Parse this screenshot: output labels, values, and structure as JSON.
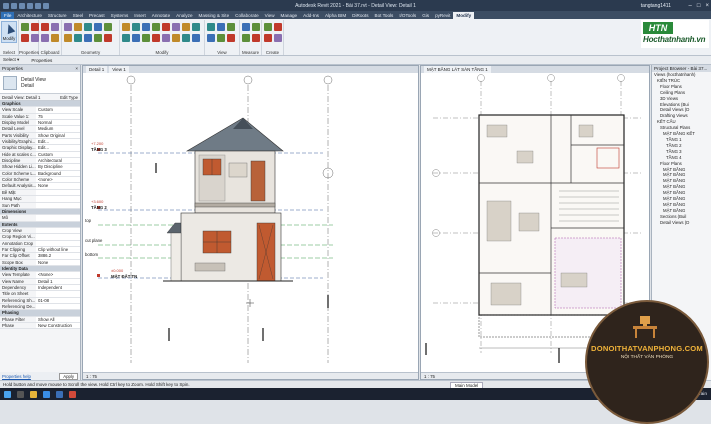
{
  "app": {
    "title": "Autodesk Revit 2021 - Bài 37.rvt - Detail View: Detail 1",
    "user": "tangtang1411"
  },
  "tabs": [
    "File",
    "Architecture",
    "Structure",
    "Steel",
    "Precast",
    "Systems",
    "Insert",
    "Annotate",
    "Analyze",
    "Massing & Site",
    "Collaborate",
    "View",
    "Manage",
    "Add-Ins",
    "Alpha BIM",
    "DiRoots",
    "Bot Tools",
    "I/OTools",
    "Gis",
    "pyRevit",
    "Modify"
  ],
  "active_tab": "Modify",
  "ribbon_groups": [
    "Select",
    "Properties",
    "Clipboard",
    "Geometry",
    "Modify",
    "View",
    "Measure",
    "Create"
  ],
  "modify_button": "Modify",
  "logo": {
    "mark": "HTN",
    "text": "Hocthatnhanh.vn",
    "color": "#2a8a3a"
  },
  "options_bar": {
    "select_label": "Select ▾",
    "properties_label": "Properties"
  },
  "properties": {
    "title": "Properties",
    "type_name": "Detail View",
    "type_sub": "Detail",
    "instance_label": "Detail View: Detail 1",
    "edit_type": "Edit Type",
    "rows": [
      {
        "section": "Graphics"
      },
      {
        "k": "View Scale",
        "v": "Custom"
      },
      {
        "k": "Scale Value 1:",
        "v": "75"
      },
      {
        "k": "Display Model",
        "v": "Normal"
      },
      {
        "k": "Detail Level",
        "v": "Medium"
      },
      {
        "k": "Parts Visibility",
        "v": "Show Original"
      },
      {
        "k": "Visibility/Graphi...",
        "v": "Edit..."
      },
      {
        "k": "Graphic Display...",
        "v": "Edit..."
      },
      {
        "k": "Hide at scales c...",
        "v": "Custom"
      },
      {
        "k": "Discipline",
        "v": "Architectural"
      },
      {
        "k": "Show Hidden Li...",
        "v": "By Discipline"
      },
      {
        "k": "Color Scheme L...",
        "v": "Background"
      },
      {
        "k": "Color Scheme",
        "v": "<none>"
      },
      {
        "k": "Default Analysis...",
        "v": "None"
      },
      {
        "k": "Bề Mặt",
        "v": ""
      },
      {
        "k": "Hang Mục",
        "v": ""
      },
      {
        "k": "Sun Path",
        "v": ""
      },
      {
        "section": "Dimensions"
      },
      {
        "k": "Mô",
        "v": ""
      },
      {
        "section": "Extents"
      },
      {
        "k": "Crop View",
        "v": ""
      },
      {
        "k": "Crop Region Vi...",
        "v": ""
      },
      {
        "k": "Annotation Crop",
        "v": ""
      },
      {
        "k": "Far Clipping",
        "v": "Clip without line"
      },
      {
        "k": "Far Clip Offset",
        "v": "3886.2"
      },
      {
        "k": "Scope Box",
        "v": "None"
      },
      {
        "section": "Identity Data"
      },
      {
        "k": "View Template",
        "v": "<None>"
      },
      {
        "k": "View Name",
        "v": "Detail 1"
      },
      {
        "k": "Dependency",
        "v": "Independent"
      },
      {
        "k": "Title on Sheet",
        "v": ""
      },
      {
        "k": "Referencing Sh...",
        "v": "01-08"
      },
      {
        "k": "Referencing De...",
        "v": ""
      },
      {
        "section": "Phasing"
      },
      {
        "k": "Phase Filter",
        "v": "Show All"
      },
      {
        "k": "Phase",
        "v": "New Construction"
      }
    ],
    "help_link": "Properties help",
    "apply": "Apply"
  },
  "views": {
    "left_tabs": [
      "Detail 1",
      "View 1"
    ],
    "right_tab": "MẶT BẰNG LÁT SÀN TẦNG 1",
    "left_scale": "1 : 75",
    "right_scale": "1 : 75",
    "levels": [
      "TẦNG 3",
      "TẦNG 2",
      "top",
      "cut plane",
      "bottom",
      "MẶT ĐẤT TN"
    ],
    "level_elev": [
      "+7.200",
      "+3.600",
      "±0.000"
    ]
  },
  "browser": {
    "title": "Project Browser - Bài 37...",
    "items": [
      "Views (hocthatnhanh)",
      "KIẾN TRÚC",
      "Floor Plans",
      "Ceiling Plans",
      "3D Views",
      "Elevations (Bui",
      "Detail Views (D",
      "Drafting Views",
      "KẾT CẤU",
      "Structural Plans",
      "MẶT BẰNG KẾT",
      "TẦNG 1",
      "TẦNG 2",
      "TẦNG 3",
      "TẦNG 4",
      "Floor Plans",
      "MẶT BẰNG",
      "MẶT BẰNG",
      "MẶT BẰNG",
      "MẶT BẰNG",
      "MẶT BẰNG",
      "MẶT BẰNG",
      "MẶT BẰNG",
      "MẶT BẰNG",
      "Sections (Buil",
      "Detail Views (D"
    ]
  },
  "status_bar": "Hold button and move mouse to Scroll the view. Hold Ctrl key to Zoom. Hold Shift key to Spin.",
  "view_model": "Main Model",
  "taskbar": {
    "temp": "24°C",
    "weather": "Light rain"
  },
  "watermark": {
    "title": "DONOITHATVANPHONG.COM",
    "subtitle": "NỘI THẤT VĂN PHÒNG"
  }
}
